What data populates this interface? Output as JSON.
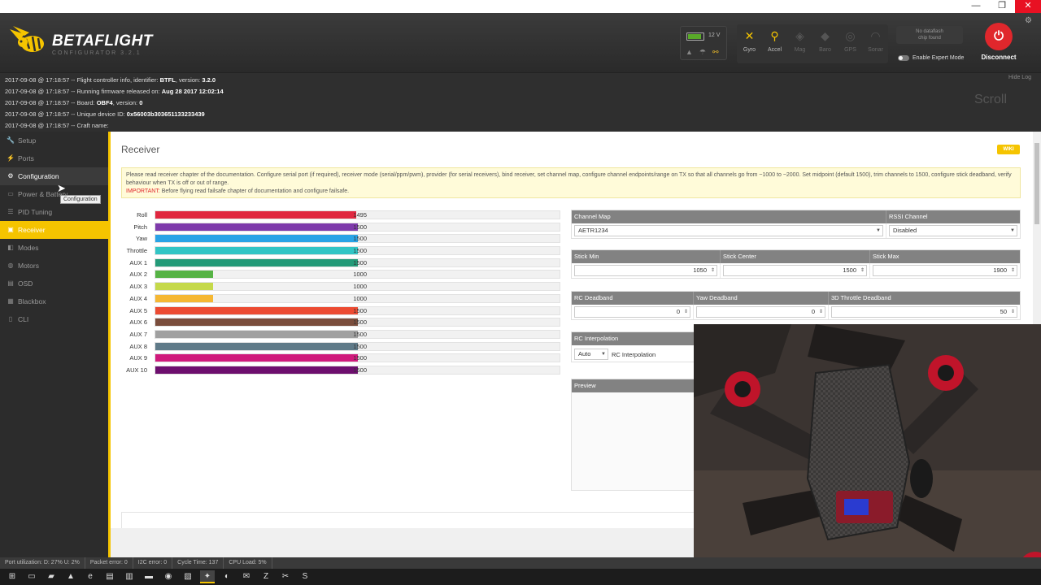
{
  "window": {
    "minimize": "—",
    "maximize": "❐",
    "close": "✕"
  },
  "header": {
    "logo_text": "BETAFLIGHT",
    "logo_sub": "CONFIGURATOR 3.2.1",
    "battery_voltage": "12 V",
    "battery_level": 0.8,
    "sensors": [
      {
        "icon": "gyro-icon",
        "glyph": "✕",
        "label": "Gyro",
        "active": true
      },
      {
        "icon": "accel-icon",
        "glyph": "⚲",
        "label": "Accel",
        "active": true
      },
      {
        "icon": "mag-icon",
        "glyph": "◈",
        "label": "Mag",
        "active": false
      },
      {
        "icon": "baro-icon",
        "glyph": "◆",
        "label": "Baro",
        "active": false
      },
      {
        "icon": "gps-icon",
        "glyph": "◎",
        "label": "GPS",
        "active": false
      },
      {
        "icon": "sonar-icon",
        "glyph": "◠",
        "label": "Sonar",
        "active": false
      }
    ],
    "dataflash_line1": "No dataflash",
    "dataflash_line2": "chip found",
    "expert_mode_label": "Enable Expert Mode",
    "disconnect_label": "Disconnect"
  },
  "log": {
    "hide_label": "Hide Log",
    "scroll_label": "Scroll",
    "lines": [
      {
        "prefix": "2017-09-08 @ 17:18:57 -- Flight controller info, identifier: ",
        "bold": "BTFL",
        "mid": ", version: ",
        "bold2": "3.2.0"
      },
      {
        "prefix": "2017-09-08 @ 17:18:57 -- Running firmware released on: ",
        "bold": "Aug 28 2017 12:02:14",
        "mid": "",
        "bold2": ""
      },
      {
        "prefix": "2017-09-08 @ 17:18:57 -- Board: ",
        "bold": "OBF4",
        "mid": ", version: ",
        "bold2": "0"
      },
      {
        "prefix": "2017-09-08 @ 17:18:57 -- Unique device ID: ",
        "bold": "0x56003b303651133233439",
        "mid": "",
        "bold2": ""
      },
      {
        "prefix": "2017-09-08 @ 17:18:57 -- Craft name: ",
        "bold": "",
        "mid": "",
        "bold2": ""
      }
    ]
  },
  "sidebar": {
    "items": [
      {
        "label": "Setup",
        "icon": "wrench-icon",
        "glyph": "🔧",
        "state": ""
      },
      {
        "label": "Ports",
        "icon": "plug-icon",
        "glyph": "⚡",
        "state": ""
      },
      {
        "label": "Configuration",
        "icon": "gear-icon",
        "glyph": "⚙",
        "state": "hover"
      },
      {
        "label": "Power & Battery",
        "icon": "battery-icon",
        "glyph": "▭",
        "state": ""
      },
      {
        "label": "PID Tuning",
        "icon": "sliders-icon",
        "glyph": "☰",
        "state": ""
      },
      {
        "label": "Receiver",
        "icon": "receiver-icon",
        "glyph": "▣",
        "state": "active"
      },
      {
        "label": "Modes",
        "icon": "modes-icon",
        "glyph": "◧",
        "state": ""
      },
      {
        "label": "Motors",
        "icon": "motor-icon",
        "glyph": "◍",
        "state": ""
      },
      {
        "label": "OSD",
        "icon": "osd-icon",
        "glyph": "▤",
        "state": ""
      },
      {
        "label": "Blackbox",
        "icon": "blackbox-icon",
        "glyph": "▦",
        "state": ""
      },
      {
        "label": "CLI",
        "icon": "cli-icon",
        "glyph": "▯",
        "state": ""
      }
    ],
    "tooltip": "Configuration"
  },
  "content": {
    "title": "Receiver",
    "wiki": "WIKI",
    "note": "Please read receiver chapter of the documentation. Configure serial port (if required), receiver mode (serial/ppm/pwm), provider (for serial receivers), bind receiver, set channel map, configure channel endpoints/range on TX so that all channels go from ~1000 to ~2000. Set midpoint (default 1500), trim channels to 1500, configure stick deadband, verify behaviour when TX is off or out of range.",
    "note_important": "IMPORTANT:",
    "note_important_text": " Before flying read failsafe chapter of documentation and configure failsafe."
  },
  "channels": [
    {
      "label": "Roll",
      "value": 1495,
      "display": "1495",
      "color": "#e0273f"
    },
    {
      "label": "Pitch",
      "value": 1500,
      "display": "1500",
      "color": "#7e3aab"
    },
    {
      "label": "Yaw",
      "value": 1500,
      "display": "1500",
      "color": "#29a3e6"
    },
    {
      "label": "Throttle",
      "value": 1500,
      "display": "1500",
      "color": "#32c5c5"
    },
    {
      "label": "AUX 1",
      "value": 1500,
      "display": "1500",
      "color": "#239a78"
    },
    {
      "label": "AUX 2",
      "value": 1000,
      "display": "1000",
      "color": "#56b345"
    },
    {
      "label": "AUX 3",
      "value": 1000,
      "display": "1000",
      "color": "#c5d94a"
    },
    {
      "label": "AUX 4",
      "value": 1000,
      "display": "1000",
      "color": "#f5b733"
    },
    {
      "label": "AUX 5",
      "value": 1500,
      "display": "1500",
      "color": "#ec4b32"
    },
    {
      "label": "AUX 6",
      "value": 1500,
      "display": "1500",
      "color": "#7a4d3c"
    },
    {
      "label": "AUX 7",
      "value": 1500,
      "display": "1500",
      "color": "#a0a0a0"
    },
    {
      "label": "AUX 8",
      "value": 1500,
      "display": "1500",
      "color": "#5f7a88"
    },
    {
      "label": "AUX 9",
      "value": 1500,
      "display": "1500",
      "color": "#d01a7c"
    },
    {
      "label": "AUX 10",
      "value": 1500,
      "display": "1500",
      "color": "#6d0f6e"
    }
  ],
  "channel_range": [
    800,
    2200
  ],
  "channel_map": {
    "header": "Channel Map",
    "value": "AETR1234"
  },
  "rssi": {
    "header": "RSSI Channel",
    "value": "Disabled"
  },
  "sticks": {
    "min_label": "Stick Min",
    "min": "1050",
    "center_label": "Stick Center",
    "center": "1500",
    "max_label": "Stick Max",
    "max": "1900"
  },
  "deadband": {
    "rc_label": "RC Deadband",
    "rc": "0",
    "yaw_label": "Yaw Deadband",
    "yaw": "0",
    "throttle_label": "3D Throttle Deadband",
    "throttle": "50"
  },
  "interpolation": {
    "header": "RC Interpolation",
    "value": "Auto",
    "label": "RC Interpolation"
  },
  "preview": {
    "header": "Preview"
  },
  "statusbar": [
    "Port utilization: D: 27% U: 2%",
    "Packet error: 0",
    "I2C error: 0",
    "Cycle Time: 137",
    "CPU Load: 5%"
  ],
  "taskbar": [
    {
      "icon": "windows-start-icon",
      "glyph": "⊞"
    },
    {
      "icon": "task-view-icon",
      "glyph": "▭"
    },
    {
      "icon": "file-explorer-icon",
      "glyph": "▰"
    },
    {
      "icon": "vlc-icon",
      "glyph": "▲"
    },
    {
      "icon": "edge-icon",
      "glyph": "e"
    },
    {
      "icon": "notepad-icon",
      "glyph": "▤"
    },
    {
      "icon": "notes-icon",
      "glyph": "▥"
    },
    {
      "icon": "screen-icon",
      "glyph": "▬"
    },
    {
      "icon": "chrome-icon",
      "glyph": "◉"
    },
    {
      "icon": "app-icon",
      "glyph": "▧"
    },
    {
      "icon": "betaflight-icon",
      "glyph": "✦"
    },
    {
      "icon": "bluetooth-icon",
      "glyph": "◐"
    },
    {
      "icon": "mail-icon",
      "glyph": "✉"
    },
    {
      "icon": "filezilla-icon",
      "glyph": "Z"
    },
    {
      "icon": "tool-icon",
      "glyph": "✂"
    },
    {
      "icon": "skype-icon",
      "glyph": "S"
    }
  ]
}
